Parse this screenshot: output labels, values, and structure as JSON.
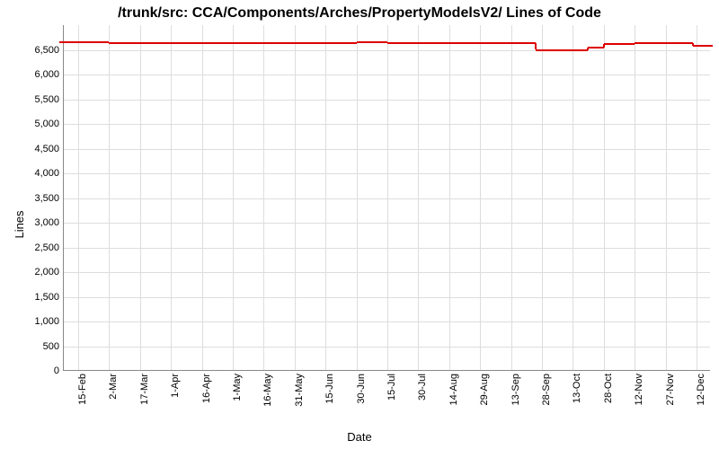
{
  "chart_data": {
    "type": "line",
    "title": "/trunk/src: CCA/Components/Arches/PropertyModelsV2/ Lines of Code",
    "xlabel": "Date",
    "ylabel": "Lines",
    "ylim": [
      0,
      7000
    ],
    "yticks": [
      0,
      500,
      1000,
      1500,
      2000,
      2500,
      3000,
      3500,
      4000,
      4500,
      5000,
      5500,
      6000,
      6500
    ],
    "xticks": [
      "15-Feb",
      "2-Mar",
      "17-Mar",
      "1-Apr",
      "16-Apr",
      "1-May",
      "16-May",
      "31-May",
      "15-Jun",
      "30-Jun",
      "15-Jul",
      "30-Jul",
      "14-Aug",
      "29-Aug",
      "13-Sep",
      "28-Sep",
      "13-Oct",
      "28-Oct",
      "12-Nov",
      "27-Nov",
      "12-Dec"
    ],
    "series": [
      {
        "name": "Lines of Code",
        "color": "#d00",
        "points": [
          {
            "x": "1-Feb",
            "y": 6650
          },
          {
            "x": "15-Feb",
            "y": 6650
          },
          {
            "x": "2-Mar",
            "y": 6640
          },
          {
            "x": "17-Mar",
            "y": 6640
          },
          {
            "x": "1-Apr",
            "y": 6640
          },
          {
            "x": "16-Apr",
            "y": 6640
          },
          {
            "x": "1-May",
            "y": 6640
          },
          {
            "x": "16-May",
            "y": 6640
          },
          {
            "x": "31-May",
            "y": 6640
          },
          {
            "x": "15-Jun",
            "y": 6640
          },
          {
            "x": "30-Jun",
            "y": 6650
          },
          {
            "x": "15-Jul",
            "y": 6640
          },
          {
            "x": "30-Jul",
            "y": 6640
          },
          {
            "x": "14-Aug",
            "y": 6640
          },
          {
            "x": "29-Aug",
            "y": 6640
          },
          {
            "x": "13-Sep",
            "y": 6640
          },
          {
            "x": "25-Sep",
            "y": 6640
          },
          {
            "x": "25-Sep",
            "y": 6500
          },
          {
            "x": "13-Oct",
            "y": 6500
          },
          {
            "x": "20-Oct",
            "y": 6550
          },
          {
            "x": "28-Oct",
            "y": 6550
          },
          {
            "x": "28-Oct",
            "y": 6620
          },
          {
            "x": "12-Nov",
            "y": 6620
          },
          {
            "x": "12-Nov",
            "y": 6640
          },
          {
            "x": "27-Nov",
            "y": 6640
          },
          {
            "x": "10-Dec",
            "y": 6640
          },
          {
            "x": "10-Dec",
            "y": 6580
          },
          {
            "x": "20-Dec",
            "y": 6580
          }
        ]
      }
    ]
  }
}
